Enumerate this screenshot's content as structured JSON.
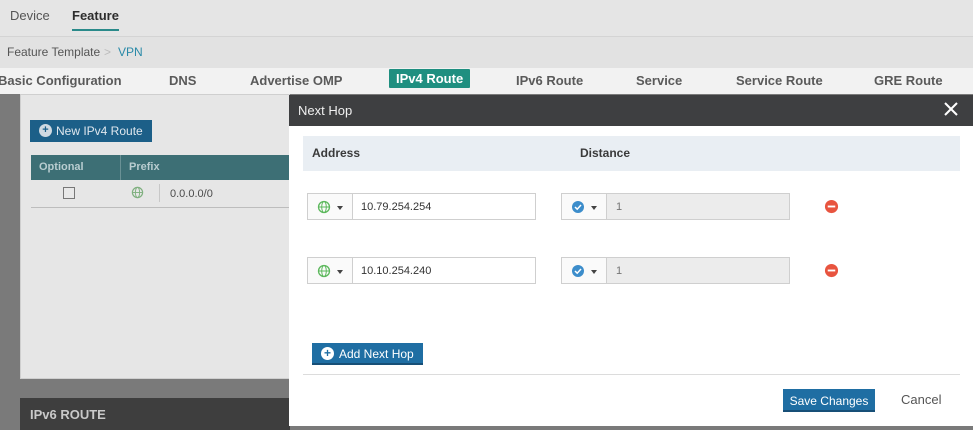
{
  "top_tabs": [
    {
      "label": "Device",
      "active": false
    },
    {
      "label": "Feature",
      "active": true
    }
  ],
  "breadcrumb": {
    "parent": "Feature Template",
    "separator": ">",
    "current": "VPN"
  },
  "section_tabs": [
    {
      "label": "Basic Configuration",
      "active": false
    },
    {
      "label": "DNS",
      "active": false
    },
    {
      "label": "Advertise OMP",
      "active": false
    },
    {
      "label": "IPv4 Route",
      "active": true
    },
    {
      "label": "IPv6 Route",
      "active": false
    },
    {
      "label": "Service",
      "active": false
    },
    {
      "label": "Service Route",
      "active": false
    },
    {
      "label": "GRE Route",
      "active": false
    }
  ],
  "ipv4_panel": {
    "new_button": "New IPv4 Route",
    "columns": [
      "Optional",
      "Prefix"
    ],
    "rows": [
      {
        "optional": false,
        "prefix": "0.0.0.0/0"
      }
    ]
  },
  "ipv6_panel": {
    "title": "IPv6 ROUTE"
  },
  "modal": {
    "title": "Next Hop",
    "columns": {
      "address": "Address",
      "distance": "Distance"
    },
    "hops": [
      {
        "address": "10.79.254.254",
        "distance_placeholder": "1"
      },
      {
        "address": "10.10.254.240",
        "distance_placeholder": "1"
      }
    ],
    "add_button": "Add Next Hop",
    "save_button": "Save Changes",
    "cancel_button": "Cancel"
  },
  "colors": {
    "accent": "#1f8f80",
    "primary_button": "#1f6ea3",
    "remove": "#e8543f",
    "global_icon": "#5cb85c",
    "check_icon": "#3c8dcb"
  },
  "icons": {
    "address_type": "globe-icon",
    "distance_type": "check-circle-icon",
    "remove": "minus-circle-icon",
    "close": "close-icon"
  }
}
